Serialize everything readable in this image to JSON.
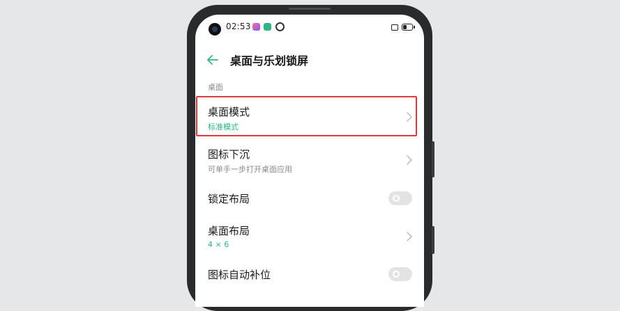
{
  "status_bar": {
    "time": "02:53",
    "icons": [
      "camera-icon",
      "app-notification-icon",
      "app-notification-icon",
      "location-icon",
      "screenshot-icon",
      "battery-icon"
    ]
  },
  "header": {
    "back_icon": "back-arrow-icon",
    "title": "桌面与乐划锁屏"
  },
  "section": {
    "label": "桌面"
  },
  "settings": [
    {
      "title": "桌面模式",
      "subtitle": "标准模式",
      "control": "chevron"
    },
    {
      "title": "图标下沉",
      "subtitle": "可单手一步打开桌面应用",
      "control": "chevron"
    },
    {
      "title": "锁定布局",
      "subtitle": "",
      "control": "toggle",
      "toggle_on": false
    },
    {
      "title": "桌面布局",
      "subtitle": "4 × 6",
      "control": "chevron"
    },
    {
      "title": "图标自动补位",
      "subtitle": "",
      "control": "toggle",
      "toggle_on": false
    }
  ],
  "colors": {
    "accent": "#2fb38a",
    "highlight": "#e03a3a",
    "background": "#e6e7e9"
  }
}
